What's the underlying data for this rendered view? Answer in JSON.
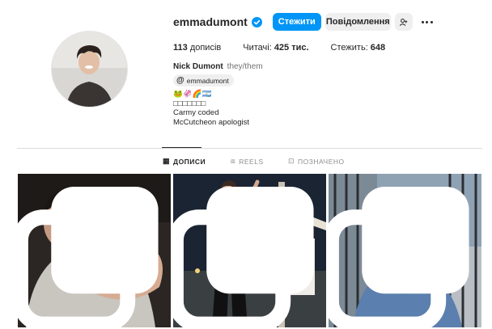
{
  "profile": {
    "username": "emmadumont",
    "verified": true,
    "follow_label": "Стежити",
    "message_label": "Повідомлення",
    "stats": [
      {
        "value": "113",
        "label": "дописів"
      },
      {
        "label": "Читачі:",
        "value": "425 тис."
      },
      {
        "label": "Стежить:",
        "value": "648"
      }
    ],
    "full_name": "Nick Dumont",
    "pronouns": "they/them",
    "threads_handle": "emmadumont",
    "bio_lines": [
      "🐸🦑🌈🇦🇷",
      "□□□□□□□",
      "Carmy coded",
      "McCutcheon apologist"
    ]
  },
  "tabs": [
    {
      "label": "ДОПИСИ",
      "icon": "grid-icon",
      "active": true
    },
    {
      "label": "REELS",
      "icon": "reels-icon",
      "active": false
    },
    {
      "label": "ПОЗНАЧЕНО",
      "icon": "tagged-icon",
      "active": false
    }
  ],
  "colors": {
    "accent": "#0095f6",
    "verified": "#0095f6",
    "button_bg": "#efefef"
  }
}
